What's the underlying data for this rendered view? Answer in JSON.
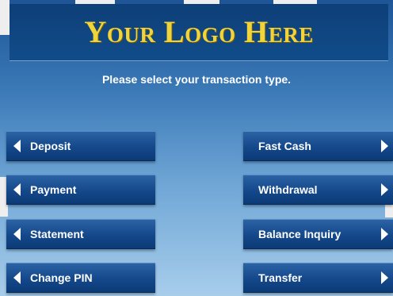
{
  "header": {
    "logo_text": "Your Logo Here"
  },
  "prompt": "Please select your transaction type.",
  "left_buttons": [
    {
      "label": "Deposit"
    },
    {
      "label": "Payment"
    },
    {
      "label": "Statement"
    },
    {
      "label": "Change PIN"
    }
  ],
  "right_buttons": [
    {
      "label": "Fast Cash"
    },
    {
      "label": "Withdrawal"
    },
    {
      "label": "Balance Inquiry"
    },
    {
      "label": "Transfer"
    }
  ],
  "colors": {
    "logo": "#f1d33a",
    "header_bg": "#0e3f78",
    "button": "#14488a",
    "text": "#ffffff"
  }
}
